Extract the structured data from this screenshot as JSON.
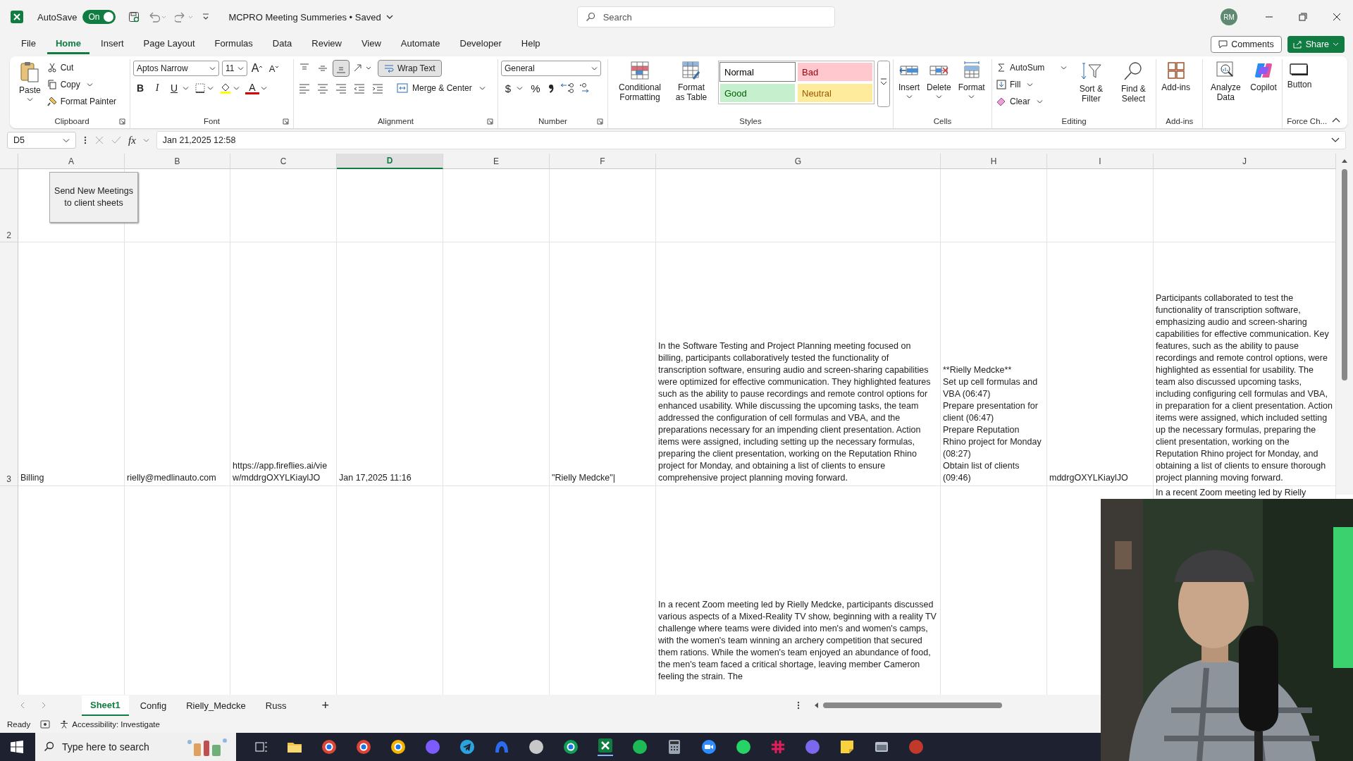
{
  "title_bar": {
    "autosave_label": "AutoSave",
    "autosave": {
      "on": true,
      "label": "On"
    },
    "document_title": "MCPRO Meeting Summeries • Saved",
    "search": {
      "placeholder": "Search"
    },
    "account": "RM"
  },
  "menu": [
    {
      "label": "File",
      "selected": false
    },
    {
      "label": "Home",
      "selected": true
    },
    {
      "label": "Insert",
      "selected": false
    },
    {
      "label": "Page Layout",
      "selected": false
    },
    {
      "label": "Formulas",
      "selected": false
    },
    {
      "label": "Data",
      "selected": false
    },
    {
      "label": "Review",
      "selected": false
    },
    {
      "label": "View",
      "selected": false
    },
    {
      "label": "Automate",
      "selected": false
    },
    {
      "label": "Developer",
      "selected": false
    },
    {
      "label": "Help",
      "selected": false
    }
  ],
  "actions": {
    "comments": "Comments",
    "share": "Share"
  },
  "ribbon": {
    "clipboard": {
      "paste": "Paste",
      "cut": "Cut",
      "copy": "Copy",
      "format_painter": "Format Painter",
      "label": "Clipboard"
    },
    "font": {
      "name": "Aptos Narrow",
      "size": "11",
      "grow": "A",
      "shrink": "A",
      "bold": "B",
      "italic": "I",
      "underline": "U",
      "font_color": "A",
      "label": "Font"
    },
    "alignment": {
      "bottom_align": {
        "on": true
      },
      "wrap_text": {
        "label": "Wrap Text",
        "on": true
      },
      "merge": "Merge & Center",
      "label": "Alignment"
    },
    "number": {
      "format": "General",
      "currency": "$",
      "percent": "%",
      "label": "Number"
    },
    "styles": {
      "conditional_formatting": "Conditional Formatting",
      "format_as_table": "Format as Table",
      "gallery": [
        {
          "label": "Normal",
          "kind": "normal",
          "color": "#ffffff"
        },
        {
          "label": "Bad",
          "kind": "bad",
          "color": "#ffc7ce"
        },
        {
          "label": "Good",
          "kind": "good",
          "color": "#c6efce"
        },
        {
          "label": "Neutral",
          "kind": "neutral",
          "color": "#ffeb9c"
        }
      ],
      "label": "Styles"
    },
    "cells": {
      "insert": "Insert",
      "delete": "Delete",
      "format": "Format",
      "label": "Cells"
    },
    "editing": {
      "autosum": "AutoSum",
      "fill": "Fill",
      "clear": "Clear",
      "sort_filter": "Sort & Filter",
      "find_select": "Find & Select",
      "label": "Editing"
    },
    "addins": {
      "addins": "Add-ins",
      "label": "Add-ins"
    },
    "analysis": {
      "analyze_data": "Analyze Data",
      "copilot": "Copilot"
    },
    "force": {
      "button": "Button",
      "label": "Force Ch..."
    }
  },
  "formula_bar": {
    "name_box": "D5",
    "function_label": "fx",
    "content": "Jan 21,2025 12:58"
  },
  "sheet": {
    "columns": [
      {
        "label": "A",
        "selected": false
      },
      {
        "label": "B",
        "selected": false
      },
      {
        "label": "C",
        "selected": false
      },
      {
        "label": "D",
        "selected": true
      },
      {
        "label": "E",
        "selected": false
      },
      {
        "label": "F",
        "selected": false
      },
      {
        "label": "G",
        "selected": false
      },
      {
        "label": "H",
        "selected": false
      },
      {
        "label": "I",
        "selected": false
      },
      {
        "label": "J",
        "selected": false
      }
    ],
    "rows": [
      {
        "header": "2"
      },
      {
        "header": "3",
        "cells": [
          "Billing",
          "rielly@medlinauto.com",
          "https://app.fireflies.ai/view/mddrgOXYLKiaylJO",
          "Jan 17,2025 11:16",
          "",
          "\"Rielly Medcke\"|",
          "In the Software Testing and Project Planning meeting focused on billing, participants collaboratively tested the functionality of transcription software, ensuring audio and screen-sharing capabilities were optimized for effective communication. They highlighted features such as the ability to pause recordings and remote control options for enhanced usability. While discussing the upcoming tasks, the team addressed the configuration of cell formulas and VBA, and the preparations necessary for an impending client presentation. Action items were assigned, including setting up the necessary formulas, preparing the client presentation, working on the Reputation Rhino project for Monday, and obtaining a list of clients to ensure comprehensive project planning moving forward.",
          "**Rielly Medcke**\nSet up cell formulas and VBA (06:47)\nPrepare presentation for client (06:47)\nPrepare Reputation Rhino project for Monday (08:27)\nObtain list of clients (09:46)",
          "mddrgOXYLKiaylJO",
          "Participants collaborated to test the functionality of transcription software, emphasizing audio and screen-sharing capabilities for effective communication. Key features, such as the ability to pause recordings and remote control options, were highlighted as essential for usability. The team also discussed upcoming tasks, including configuring cell formulas and VBA, in preparation for a client presentation. Action items were assigned, which included setting up the necessary formulas, preparing the client presentation, working on the Reputation Rhino project for Monday, and obtaining a list of clients to ensure thorough project planning moving forward."
        ]
      },
      {
        "cells": [
          "",
          "",
          "",
          "",
          "",
          "",
          "In a recent Zoom meeting led by Rielly Medcke, participants discussed various aspects of a Mixed-Reality TV show, beginning with a reality TV challenge where teams were divided into men's and women's camps, with the women's team winning an archery competition that secured them rations. While the women's team enjoyed an abundance of food, the men's team faced a critical shortage, leaving member Cameron feeling the strain. The",
          "",
          "",
          "In a recent Zoom meeting led by Rielly"
        ]
      }
    ],
    "macro_button": "Send New Meetings to client sheets"
  },
  "sheet_tabs": [
    {
      "label": "Sheet1",
      "selected": true
    },
    {
      "label": "Config",
      "selected": false
    },
    {
      "label": "Rielly_Medcke",
      "selected": false
    },
    {
      "label": "Russ",
      "selected": false
    }
  ],
  "add_sheet": "+",
  "status_bar": {
    "mode": "Ready",
    "accessibility": "Accessibility: Investigate"
  },
  "taskbar": {
    "search": {
      "placeholder": "Type here to search"
    }
  }
}
